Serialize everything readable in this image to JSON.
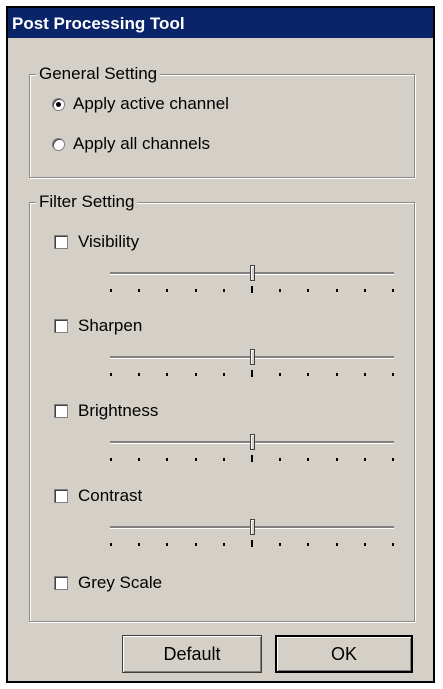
{
  "window": {
    "title": "Post Processing Tool"
  },
  "general": {
    "legend": "General Setting",
    "options": [
      {
        "label": "Apply active channel",
        "selected": true
      },
      {
        "label": "Apply all channels",
        "selected": false
      }
    ]
  },
  "filter": {
    "legend": "Filter Setting",
    "items": [
      {
        "label": "Visibility",
        "checked": false,
        "level": 0.5
      },
      {
        "label": "Sharpen",
        "checked": false,
        "level": 0.5
      },
      {
        "label": "Brightness",
        "checked": false,
        "level": 0.5
      },
      {
        "label": "Contrast",
        "checked": false,
        "level": 0.5
      }
    ],
    "grey_scale": {
      "label": "Grey Scale",
      "checked": false
    }
  },
  "buttons": {
    "default_label": "Default",
    "ok_label": "OK"
  }
}
